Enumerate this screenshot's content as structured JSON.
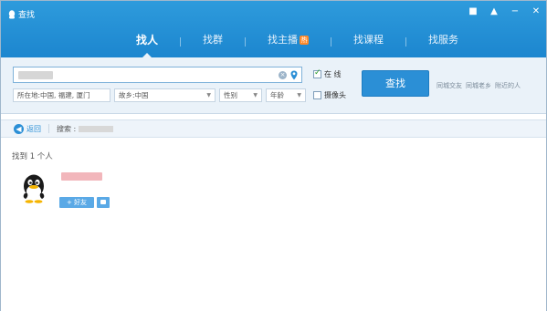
{
  "window": {
    "title": "查找"
  },
  "window_controls": [
    "■",
    "▲",
    "−",
    "✕"
  ],
  "tabs": [
    {
      "label": "找人",
      "active": true
    },
    {
      "label": "找群",
      "active": false
    },
    {
      "label": "找主播",
      "active": false,
      "badge": "热"
    },
    {
      "label": "找课程",
      "active": false
    },
    {
      "label": "找服务",
      "active": false
    }
  ],
  "search": {
    "value": "",
    "placeholder": ""
  },
  "filters": {
    "location": "所在地:中国, 福建, 厦门",
    "hometown": "故乡:中国",
    "gender": "性别",
    "age": "年龄"
  },
  "options": {
    "online_label": "在 线",
    "online_checked": true,
    "camera_label": "摄像头",
    "camera_checked": false
  },
  "find_button": "查找",
  "quick_links": [
    "同城交友",
    "同城老乡",
    "附近的人"
  ],
  "breadcrumb": {
    "back_label": "返回",
    "search_label": "搜索 :"
  },
  "results": {
    "count_text": "找到 1 个人",
    "add_friend_label": "+ 好友"
  },
  "colors": {
    "accent": "#1c86cf",
    "button": "#2b8fd6",
    "panel": "#eaf2f9"
  }
}
